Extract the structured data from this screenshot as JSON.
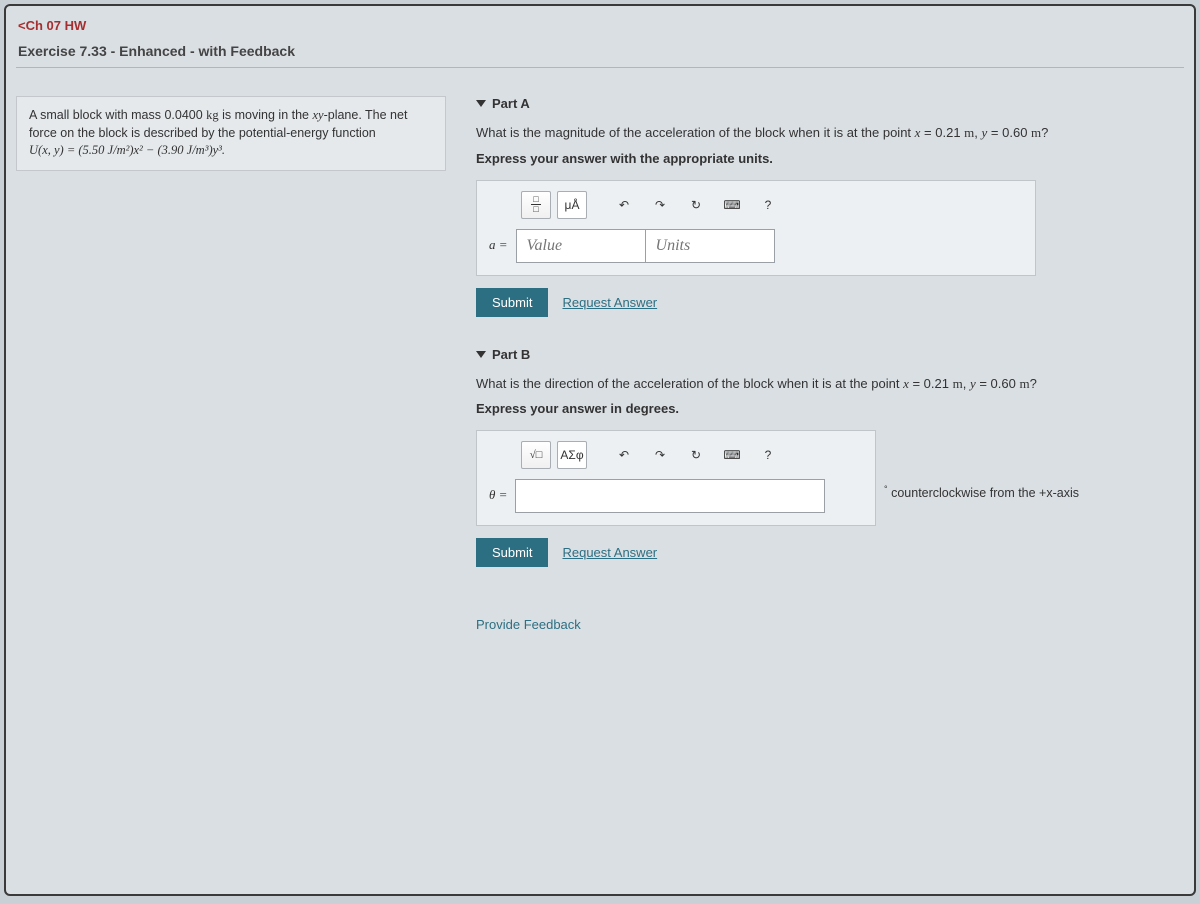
{
  "breadcrumb": "Ch 07 HW",
  "title": "Exercise 7.33 - Enhanced - with Feedback",
  "prompt": {
    "line1_a": "A small block with mass 0.0400 ",
    "line1_b": "kg",
    "line1_c": " is moving in the ",
    "line1_d": "xy",
    "line1_e": "-plane. The net force on the block is described by the potential-energy function",
    "line2": "U(x, y) = (5.50 J/m²)x² − (3.90 J/m³)y³."
  },
  "partA": {
    "header": "Part A",
    "question_a": "What is the magnitude of the acceleration of the block when it is at the point ",
    "question_b": "x",
    "question_c": " = 0.21 ",
    "question_d": "m",
    "question_e": ", ",
    "question_f": "y",
    "question_g": " = 0.60 ",
    "question_h": "m",
    "question_i": "?",
    "instruction": "Express your answer with the appropriate units.",
    "units_btn": "μÅ",
    "var": "a =",
    "value_ph": "Value",
    "units_ph": "Units",
    "submit": "Submit",
    "request": "Request Answer"
  },
  "partB": {
    "header": "Part B",
    "question_a": "What is the direction of the acceleration of the block when it is at the point ",
    "question_b": "x",
    "question_c": " = 0.21 ",
    "question_d": "m",
    "question_e": ", ",
    "question_f": "y",
    "question_g": " = 0.60 ",
    "question_h": "m",
    "question_i": "?",
    "instruction": "Express your answer in degrees.",
    "greek_btn": "ΑΣφ",
    "var": "θ =",
    "suffix": " counterclockwise from the +x-axis",
    "submit": "Submit",
    "request": "Request Answer"
  },
  "feedback": "Provide Feedback",
  "help_char": "?"
}
